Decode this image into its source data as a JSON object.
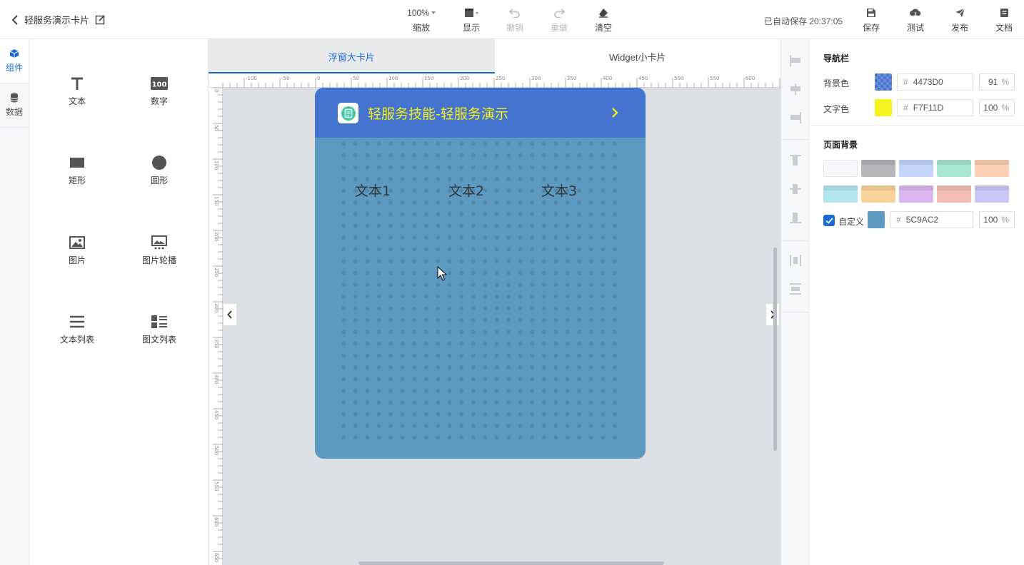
{
  "header": {
    "back_title": "轻服务演示卡片",
    "zoom_value": "100%",
    "zoom_label": "缩放",
    "display_label": "显示",
    "undo_label": "撤销",
    "redo_label": "重做",
    "clear_label": "清空",
    "autosave_text": "已自动保存 20:37:05",
    "save_label": "保存",
    "test_label": "测试",
    "publish_label": "发布",
    "docs_label": "文档"
  },
  "rail": {
    "components_label": "组件",
    "data_label": "数据"
  },
  "palette": {
    "items": [
      "文本",
      "数字",
      "矩形",
      "圆形",
      "图片",
      "图片轮播",
      "文本列表",
      "图文列表"
    ]
  },
  "tabs": [
    "浮窗大卡片",
    "Widget小卡片"
  ],
  "ruler": {
    "h_labels": [
      "-100",
      "-50",
      "0",
      "50",
      "100",
      "150",
      "200",
      "250",
      "300",
      "350",
      "400",
      "450",
      "500",
      "550",
      "600"
    ],
    "v_labels": [
      "0",
      "50",
      "100",
      "150",
      "200",
      "250",
      "300",
      "350",
      "400",
      "450",
      "500",
      "550",
      "600",
      "650"
    ]
  },
  "card": {
    "title": "轻服务技能-轻服务演示",
    "texts": [
      "文本1",
      "文本2",
      "文本3"
    ],
    "bg_color": "#5C9AC2",
    "nav_color": "#4473D0",
    "title_color": "#F7F11D"
  },
  "props": {
    "navbar_title": "导航栏",
    "bg_color_label": "背景色",
    "bg_color_hex": "4473D0",
    "bg_opacity": "91",
    "text_color_label": "文字色",
    "text_color_hex": "F7F11D",
    "text_opacity": "100",
    "pct_unit": "%",
    "hash": "#",
    "page_bg_title": "页面背景",
    "custom_label": "自定义",
    "custom_hex": "5C9AC2",
    "custom_opacity": "100",
    "preset_colors": [
      "#f7f8fa",
      "#b4b6ba",
      "#c3d5fb",
      "#a6e8cf",
      "#fcd0b4",
      "#b3e6ec",
      "#f8d49a",
      "#d9b6ee",
      "#f3bcb9",
      "#c8c8f6"
    ]
  }
}
